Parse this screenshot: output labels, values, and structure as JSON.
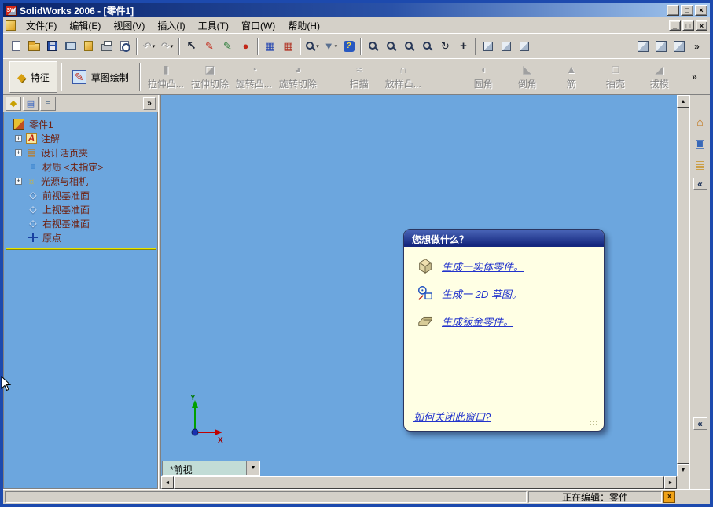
{
  "window": {
    "title": "SolidWorks 2006 - [零件1]",
    "logo_text": "SW",
    "controls": {
      "minimize": "_",
      "maximize": "□",
      "close": "×"
    },
    "doc_controls": {
      "minimize": "_",
      "restore": "□",
      "close": "×"
    }
  },
  "menu": {
    "items": [
      {
        "label": "文件(F)"
      },
      {
        "label": "编辑(E)"
      },
      {
        "label": "视图(V)"
      },
      {
        "label": "插入(I)"
      },
      {
        "label": "工具(T)"
      },
      {
        "label": "窗口(W)"
      },
      {
        "label": "帮助(H)"
      }
    ]
  },
  "toolbar": {
    "overflow": "»",
    "glyphs": {
      "undo": "↶",
      "redo": "↷",
      "dropdown": "▾",
      "select": "↖",
      "sketch": "✎",
      "edit_sketch": "✎",
      "record": "●",
      "design_table": "▦",
      "bom_table": "▦",
      "filter": "▼",
      "rotate": "↻",
      "pan": "+",
      "help": "?"
    },
    "icon_names": [
      "new-document",
      "open",
      "save",
      "make-drawing",
      "make-assembly",
      "print",
      "print-preview",
      "undo",
      "redo",
      "select",
      "sketch",
      "edit-sketch",
      "record-macro",
      "design-table",
      "bom-table",
      "view-orientation",
      "selection-filter",
      "help",
      "zoom-to-fit",
      "zoom-to-area",
      "zoom-in-out",
      "zoom-to-selection",
      "rotate-view",
      "pan",
      "wireframe",
      "shaded",
      "section-view",
      "view-cube-a",
      "view-cube-b",
      "view-cube-c"
    ]
  },
  "featurebar": {
    "overflow": "»",
    "buttons": [
      {
        "name": "features",
        "label": "特征",
        "glyph": "◆"
      },
      {
        "name": "sketch",
        "label": "草图绘制",
        "glyph": "✎"
      },
      {
        "name": "extruded-boss",
        "label": "拉伸凸...",
        "glyph": "▮"
      },
      {
        "name": "extruded-cut",
        "label": "拉伸切除",
        "glyph": "◪"
      },
      {
        "name": "revolved-boss",
        "label": "旋转凸...",
        "glyph": "◔"
      },
      {
        "name": "revolved-cut",
        "label": "旋转切除",
        "glyph": "◕"
      },
      {
        "name": "sweep",
        "label": "扫描",
        "glyph": "≈"
      },
      {
        "name": "loft",
        "label": "放样凸...",
        "glyph": "∩"
      },
      {
        "name": "fillet",
        "label": "圆角",
        "glyph": "◖"
      },
      {
        "name": "chamfer",
        "label": "倒角",
        "glyph": "◣"
      },
      {
        "name": "rib",
        "label": "筋",
        "glyph": "▲"
      },
      {
        "name": "shell",
        "label": "抽壳",
        "glyph": "□"
      },
      {
        "name": "draft",
        "label": "拔模",
        "glyph": "◢"
      }
    ]
  },
  "tree": {
    "tabs": [
      {
        "name": "featuremanager-tab",
        "glyph": "◆"
      },
      {
        "name": "propertymanager-tab",
        "glyph": "▤"
      },
      {
        "name": "configurationmanager-tab",
        "glyph": "≡"
      }
    ],
    "flyout": "»",
    "root": "零件1",
    "items": [
      {
        "label": "注解",
        "expander": "+",
        "glyph": "A"
      },
      {
        "label": "设计活页夹",
        "expander": "+",
        "glyph": "▤"
      },
      {
        "label": "材质 <未指定>",
        "glyph": "≡"
      },
      {
        "label": "光源与相机",
        "expander": "+",
        "glyph": "☼"
      },
      {
        "label": "前视基准面",
        "glyph": "◇"
      },
      {
        "label": "上视基准面",
        "glyph": "◇"
      },
      {
        "label": "右视基准面",
        "glyph": "◇"
      },
      {
        "label": "原点"
      }
    ]
  },
  "viewport": {
    "view_combo": {
      "value": "*前视",
      "arrow": "▼"
    },
    "triad": {
      "x_label": "X",
      "y_label": "Y"
    },
    "scroll": {
      "up": "▲",
      "down": "▼",
      "left": "◄",
      "right": "►"
    }
  },
  "task_dialog": {
    "title": "您想做什么？",
    "options": [
      {
        "label": "生成一实体零件。"
      },
      {
        "label": "生成一 2D 草图。"
      },
      {
        "label": "生成钣金零件。"
      }
    ],
    "footer_link": "如何关闭此窗口?"
  },
  "taskpane": {
    "icons": [
      {
        "name": "solidworks-resources",
        "glyph": "⌂"
      },
      {
        "name": "design-library",
        "glyph": "▣"
      },
      {
        "name": "file-explorer",
        "glyph": "▤"
      }
    ],
    "collapse": "«"
  },
  "statusbar": {
    "editing": "正在编辑：零件",
    "close_glyph": "x"
  },
  "colors": {
    "viewport_background": "#6CA6DE",
    "chrome": "#D4D0C8",
    "dialog_body": "#FFFFE4",
    "dialog_header": "#1B2F8A",
    "link": "#2233CC",
    "tree_text": "#6E1E0C",
    "rollback_bar": "#E8E400",
    "statusbar_close": "#F0A318"
  }
}
